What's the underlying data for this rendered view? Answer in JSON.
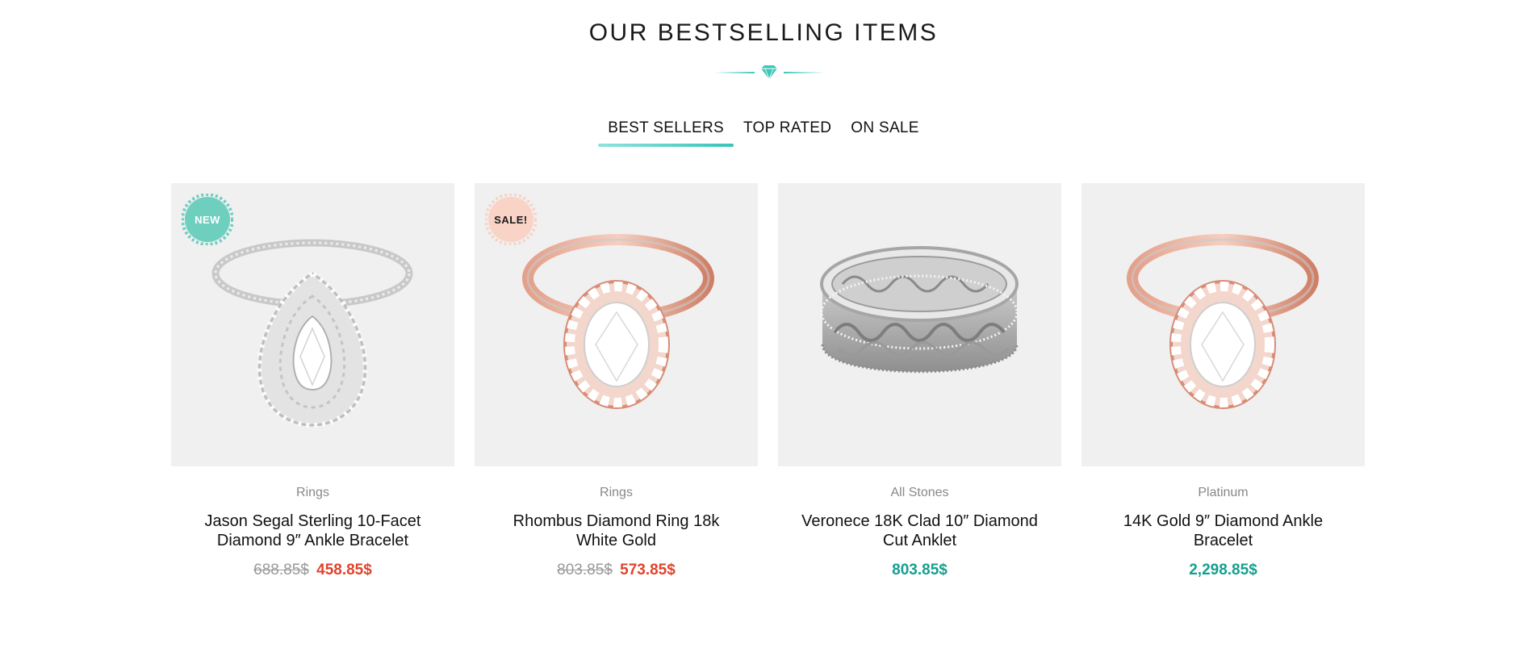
{
  "section": {
    "title": "OUR BESTSELLING ITEMS",
    "divider_icon": "diamond-icon"
  },
  "colors": {
    "accent": "#3cc7b8",
    "sale_price": "#e0442c",
    "regular_price": "#14a090",
    "new_badge": "#6fcfbf",
    "sale_badge": "#f8d3c6"
  },
  "tabs": [
    {
      "label": "BEST SELLERS",
      "active": true
    },
    {
      "label": "TOP RATED",
      "active": false
    },
    {
      "label": "ON SALE",
      "active": false
    }
  ],
  "products": [
    {
      "badge": "NEW",
      "image": "silver-pear-halo-ring",
      "category": "Rings",
      "title": "Jason Segal Sterling 10-Facet Diamond 9″ Ankle Bracelet",
      "old_price": "688.85$",
      "price": "458.85$"
    },
    {
      "badge": "SALE!",
      "image": "rose-gold-oval-halo-ring",
      "category": "Rings",
      "title": "Rhombus Diamond Ring 18k White Gold",
      "old_price": "803.85$",
      "price": "573.85$"
    },
    {
      "badge": "",
      "image": "silver-filigree-band",
      "category": "All Stones",
      "title": "Veronece 18K Clad 10″ Diamond Cut Anklet",
      "old_price": "",
      "price": "803.85$"
    },
    {
      "badge": "",
      "image": "rose-gold-oval-halo-ring",
      "category": "Platinum",
      "title": "14K Gold 9″ Diamond Ankle Bracelet",
      "old_price": "",
      "price": "2,298.85$"
    }
  ]
}
